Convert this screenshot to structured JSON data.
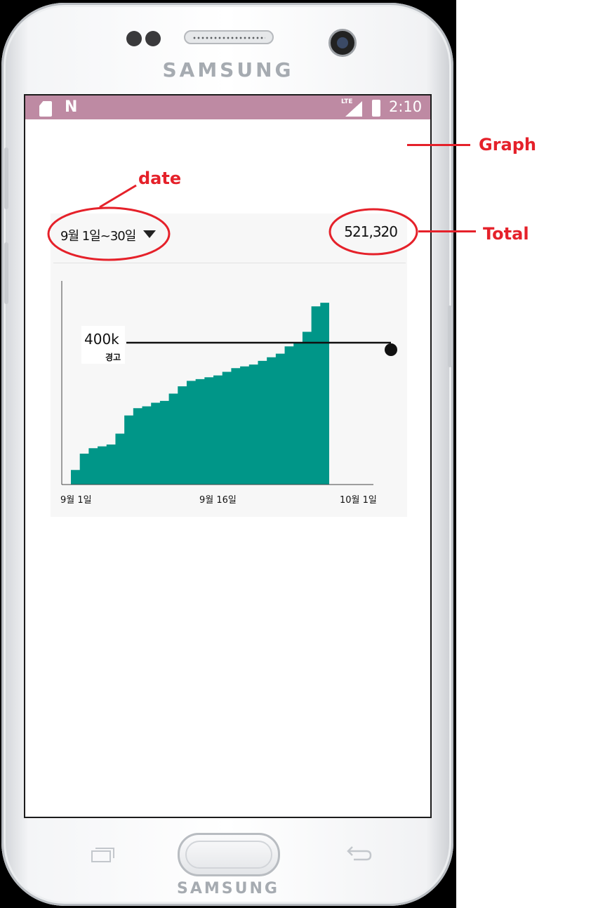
{
  "device": {
    "brand_top": "SAMSUNG",
    "brand_bottom": "SAMSUNG"
  },
  "status_bar": {
    "network": "LTE",
    "time": "2:10",
    "notification_icon": "N",
    "icons": [
      "sd-card-icon",
      "n-notification-icon",
      "lte-signal-icon",
      "battery-charging-icon"
    ]
  },
  "card": {
    "date_range": "9월 1일~30일",
    "total": "521,320"
  },
  "chart_data": {
    "type": "area",
    "x_tick_labels": [
      "9월 1일",
      "9월 16일",
      "10월 1일"
    ],
    "threshold": {
      "value_label": "400k",
      "label": "경고",
      "value": 400000
    },
    "x": [
      1,
      2,
      3,
      4,
      5,
      6,
      7,
      8,
      9,
      10,
      11,
      12,
      13,
      14,
      15,
      16,
      17,
      18,
      19,
      20,
      21,
      22,
      23,
      24,
      25,
      26,
      27,
      28,
      29,
      30
    ],
    "values": [
      40000,
      85000,
      100000,
      105000,
      110000,
      140000,
      190000,
      210000,
      215000,
      225000,
      230000,
      250000,
      270000,
      285000,
      290000,
      295000,
      300000,
      310000,
      320000,
      325000,
      330000,
      340000,
      350000,
      360000,
      380000,
      390000,
      420000,
      490000,
      500000,
      521320
    ],
    "color": "#009688",
    "threshold_color": "#111111"
  },
  "annotations": {
    "graph": "Graph",
    "date": "date",
    "total": "Total"
  },
  "colors": {
    "status_bar": "#be8aa3",
    "annotation": "#e5212a",
    "area_fill": "#009688"
  }
}
